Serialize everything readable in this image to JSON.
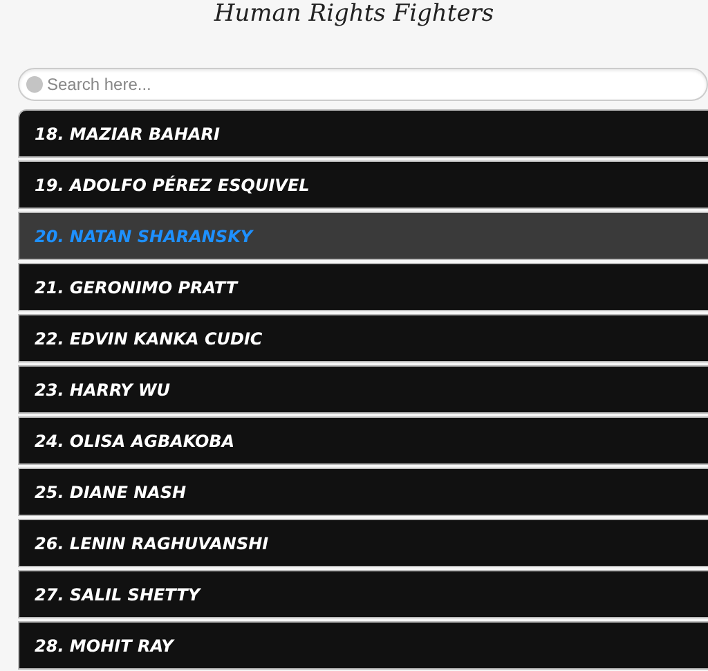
{
  "title": "Human Rights Fighters",
  "search": {
    "placeholder": "Search here..."
  },
  "items": [
    {
      "label": "18. MAZIAR BAHARI",
      "selected": false
    },
    {
      "label": "19. ADOLFO PÉREZ ESQUIVEL",
      "selected": false
    },
    {
      "label": "20. NATAN SHARANSKY",
      "selected": true
    },
    {
      "label": "21. GERONIMO PRATT",
      "selected": false
    },
    {
      "label": "22. EDVIN KANKA CUDIC",
      "selected": false
    },
    {
      "label": "23. HARRY WU",
      "selected": false
    },
    {
      "label": "24. OLISA AGBAKOBA",
      "selected": false
    },
    {
      "label": "25. DIANE NASH",
      "selected": false
    },
    {
      "label": "26. LENIN RAGHUVANSHI",
      "selected": false
    },
    {
      "label": "27. SALIL SHETTY",
      "selected": false
    },
    {
      "label": "28. MOHIT RAY",
      "selected": false
    }
  ]
}
